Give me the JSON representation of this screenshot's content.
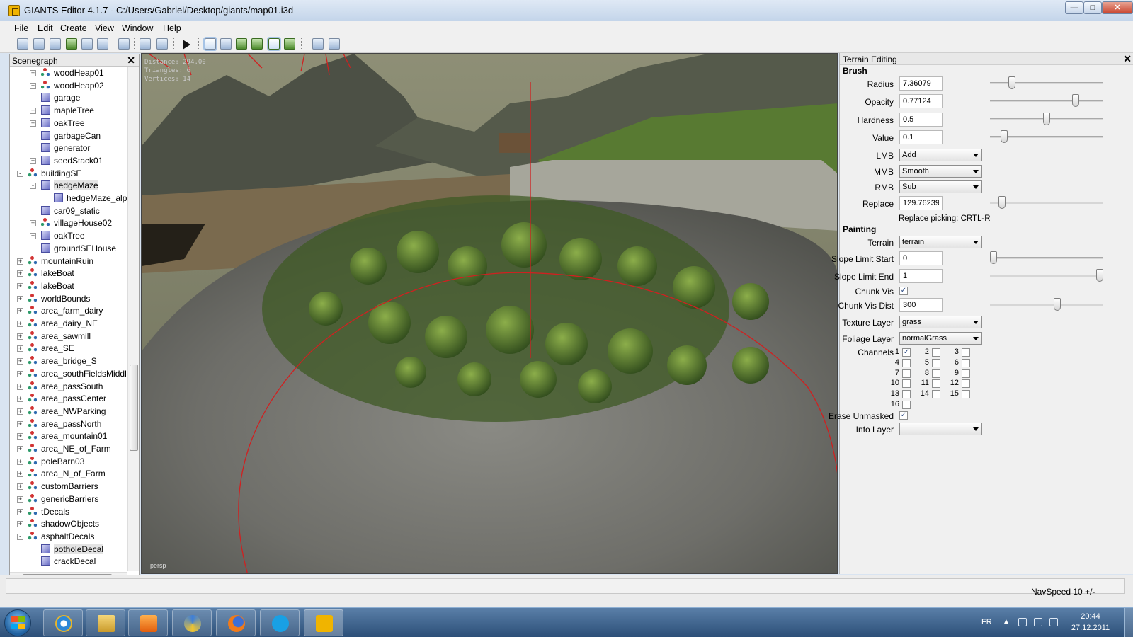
{
  "window": {
    "title": "GIANTS Editor 4.1.7 - C:/Users/Gabriel/Desktop/giants/map01.i3d",
    "min_label": "—",
    "max_label": "□",
    "close_label": "✕"
  },
  "menu": [
    "File",
    "Edit",
    "Create",
    "View",
    "Window",
    "Help"
  ],
  "toolbar_icons": [
    "new-scene-icon",
    "open-icon",
    "import-icon",
    "reload-icon",
    "save-icon",
    "save-as-icon",
    "export-icon",
    "undo-icon",
    "redo-icon",
    "play-icon",
    "select-tool-icon",
    "move-tool-icon",
    "terrain-sculpt-icon",
    "terrain-paint-icon",
    "foliage-paint-icon",
    "terrain-smooth-icon",
    "render-settings-icon",
    "render-test-icon"
  ],
  "scenegraph": {
    "title": "Scenegraph",
    "close_label": "✕",
    "items": [
      {
        "label": "woodHeap01",
        "depth": 1,
        "icon": "node",
        "expander": "+"
      },
      {
        "label": "woodHeap02",
        "depth": 1,
        "icon": "node",
        "expander": "+"
      },
      {
        "label": "garage",
        "depth": 1,
        "icon": "cube",
        "expander": ""
      },
      {
        "label": "mapleTree",
        "depth": 1,
        "icon": "cube",
        "expander": "+"
      },
      {
        "label": "oakTree",
        "depth": 1,
        "icon": "cube",
        "expander": "+"
      },
      {
        "label": "garbageCan",
        "depth": 1,
        "icon": "cube",
        "expander": ""
      },
      {
        "label": "generator",
        "depth": 1,
        "icon": "cube",
        "expander": ""
      },
      {
        "label": "seedStack01",
        "depth": 1,
        "icon": "cube",
        "expander": "+"
      },
      {
        "label": "buildingSE",
        "depth": 0,
        "icon": "node",
        "expander": "-"
      },
      {
        "label": "hedgeMaze",
        "depth": 1,
        "icon": "cube",
        "expander": "-",
        "selected": true
      },
      {
        "label": "hedgeMaze_alpha",
        "depth": 2,
        "icon": "cube",
        "expander": ""
      },
      {
        "label": "car09_static",
        "depth": 1,
        "icon": "cube",
        "expander": ""
      },
      {
        "label": "villageHouse02",
        "depth": 1,
        "icon": "node",
        "expander": "+"
      },
      {
        "label": "oakTree",
        "depth": 1,
        "icon": "cube",
        "expander": "+"
      },
      {
        "label": "groundSEHouse",
        "depth": 1,
        "icon": "cube",
        "expander": ""
      },
      {
        "label": "mountainRuin",
        "depth": 0,
        "icon": "node",
        "expander": "+"
      },
      {
        "label": "lakeBoat",
        "depth": 0,
        "icon": "node",
        "expander": "+"
      },
      {
        "label": "lakeBoat",
        "depth": 0,
        "icon": "node",
        "expander": "+"
      },
      {
        "label": "worldBounds",
        "depth": 0,
        "icon": "node",
        "expander": "+"
      },
      {
        "label": "area_farm_dairy",
        "depth": 0,
        "icon": "node",
        "expander": "+"
      },
      {
        "label": "area_dairy_NE",
        "depth": 0,
        "icon": "node",
        "expander": "+"
      },
      {
        "label": "area_sawmill",
        "depth": 0,
        "icon": "node",
        "expander": "+"
      },
      {
        "label": "area_SE",
        "depth": 0,
        "icon": "node",
        "expander": "+"
      },
      {
        "label": "area_bridge_S",
        "depth": 0,
        "icon": "node",
        "expander": "+"
      },
      {
        "label": "area_southFieldsMiddle",
        "depth": 0,
        "icon": "node",
        "expander": "+"
      },
      {
        "label": "area_passSouth",
        "depth": 0,
        "icon": "node",
        "expander": "+"
      },
      {
        "label": "area_passCenter",
        "depth": 0,
        "icon": "node",
        "expander": "+"
      },
      {
        "label": "area_NWParking",
        "depth": 0,
        "icon": "node",
        "expander": "+"
      },
      {
        "label": "area_passNorth",
        "depth": 0,
        "icon": "node",
        "expander": "+"
      },
      {
        "label": "area_mountain01",
        "depth": 0,
        "icon": "node",
        "expander": "+"
      },
      {
        "label": "area_NE_of_Farm",
        "depth": 0,
        "icon": "node",
        "expander": "+"
      },
      {
        "label": "poleBarn03",
        "depth": 0,
        "icon": "node",
        "expander": "+"
      },
      {
        "label": "area_N_of_Farm",
        "depth": 0,
        "icon": "node",
        "expander": "+"
      },
      {
        "label": "customBarriers",
        "depth": 0,
        "icon": "node",
        "expander": "+"
      },
      {
        "label": "genericBarriers",
        "depth": 0,
        "icon": "node",
        "expander": "+"
      },
      {
        "label": "tDecals",
        "depth": 0,
        "icon": "node",
        "expander": "+"
      },
      {
        "label": "shadowObjects",
        "depth": 0,
        "icon": "node",
        "expander": "+"
      },
      {
        "label": "asphaltDecals",
        "depth": 0,
        "icon": "node",
        "expander": "-"
      },
      {
        "label": "potholeDecal",
        "depth": 1,
        "icon": "cube",
        "expander": "",
        "selected": true
      },
      {
        "label": "crackDecal",
        "depth": 1,
        "icon": "cube",
        "expander": ""
      }
    ],
    "hscroll_label": "|||"
  },
  "viewport": {
    "stats": [
      "Distance: 294.00",
      "Triangles: 6",
      "Vertices: 14"
    ],
    "camera_label": "persp"
  },
  "terrain_editing": {
    "title": "Terrain Editing",
    "close_label": "✕",
    "brush_header": "Brush",
    "radius_label": "Radius",
    "radius_value": "7.36079",
    "radius_fraction": 0.17,
    "opacity_label": "Opacity",
    "opacity_value": "0.77124",
    "opacity_fraction": 0.77,
    "hardness_label": "Hardness",
    "hardness_value": "0.5",
    "hardness_fraction": 0.5,
    "value_label": "Value",
    "value_value": "0.1",
    "value_fraction": 0.1,
    "lmb_label": "LMB",
    "lmb_value": "Add",
    "mmb_label": "MMB",
    "mmb_value": "Smooth",
    "rmb_label": "RMB",
    "rmb_value": "Sub",
    "replace_label": "Replace",
    "replace_value": "129.76239",
    "replace_fraction": 0.08,
    "replace_picking": "Replace picking: CRTL-R",
    "painting_header": "Painting",
    "terrain_label": "Terrain",
    "terrain_value": "terrain",
    "slope_start_label": "Slope Limit Start",
    "slope_start_value": "0",
    "slope_start_fraction": 0.0,
    "slope_end_label": "Slope Limit End",
    "slope_end_value": "1",
    "slope_end_fraction": 1.0,
    "chunk_vis_label": "Chunk Vis",
    "chunk_vis_checked": "✓",
    "chunk_vis_dist_label": "Chunk Vis Dist",
    "chunk_vis_dist_value": "300",
    "chunk_vis_dist_fraction": 0.6,
    "texture_layer_label": "Texture Layer",
    "texture_layer_value": "grass",
    "foliage_layer_label": "Foliage Layer",
    "foliage_layer_value": "normalGrass",
    "channels_label": "Channels",
    "channels": [
      {
        "n": "1",
        "checked": "✓"
      },
      {
        "n": "2",
        "checked": ""
      },
      {
        "n": "3",
        "checked": ""
      },
      {
        "n": "4",
        "checked": ""
      },
      {
        "n": "5",
        "checked": ""
      },
      {
        "n": "6",
        "checked": ""
      },
      {
        "n": "7",
        "checked": ""
      },
      {
        "n": "8",
        "checked": ""
      },
      {
        "n": "9",
        "checked": ""
      },
      {
        "n": "10",
        "checked": ""
      },
      {
        "n": "11",
        "checked": ""
      },
      {
        "n": "12",
        "checked": ""
      },
      {
        "n": "13",
        "checked": ""
      },
      {
        "n": "14",
        "checked": ""
      },
      {
        "n": "15",
        "checked": ""
      },
      {
        "n": "16",
        "checked": ""
      }
    ],
    "erase_unmasked_label": "Erase Unmasked",
    "erase_unmasked_checked": "✓",
    "info_layer_label": "Info Layer",
    "info_layer_value": ""
  },
  "status": {
    "navspeed": "NavSpeed 10 +/-"
  },
  "taskbar": {
    "apps": [
      "internet-explorer-icon",
      "windows-explorer-icon",
      "media-player-icon",
      "tool-app-icon",
      "firefox-icon",
      "skype-icon",
      "giants-editor-icon"
    ],
    "language": "FR",
    "tray_arrow": "▲",
    "time": "20:44",
    "date": "27.12.2011"
  }
}
